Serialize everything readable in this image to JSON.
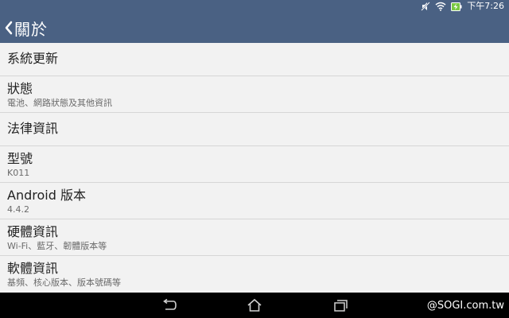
{
  "status_bar": {
    "time": "下午7:26"
  },
  "app_bar": {
    "title": "關於"
  },
  "items": [
    {
      "title": "系統更新",
      "subtitle": ""
    },
    {
      "title": "狀態",
      "subtitle": "電池、網路狀態及其他資訊"
    },
    {
      "title": "法律資訊",
      "subtitle": ""
    },
    {
      "title": "型號",
      "subtitle": "K011"
    },
    {
      "title": "Android 版本",
      "subtitle": "4.4.2"
    },
    {
      "title": "硬體資訊",
      "subtitle": "Wi-Fi、藍牙、韌體版本等"
    },
    {
      "title": "軟體資訊",
      "subtitle": "基頻、核心版本、版本號碼等"
    }
  ],
  "watermark": "@SOGI.com.tw",
  "colors": {
    "header": "#4a6183",
    "background": "#f2f2f2",
    "nav": "#000000",
    "battery": "#7ac943"
  },
  "icons": {
    "status": [
      "mute-icon",
      "wifi-icon",
      "battery-charging-icon"
    ],
    "nav": [
      "back-icon",
      "home-icon",
      "recent-apps-icon"
    ]
  }
}
